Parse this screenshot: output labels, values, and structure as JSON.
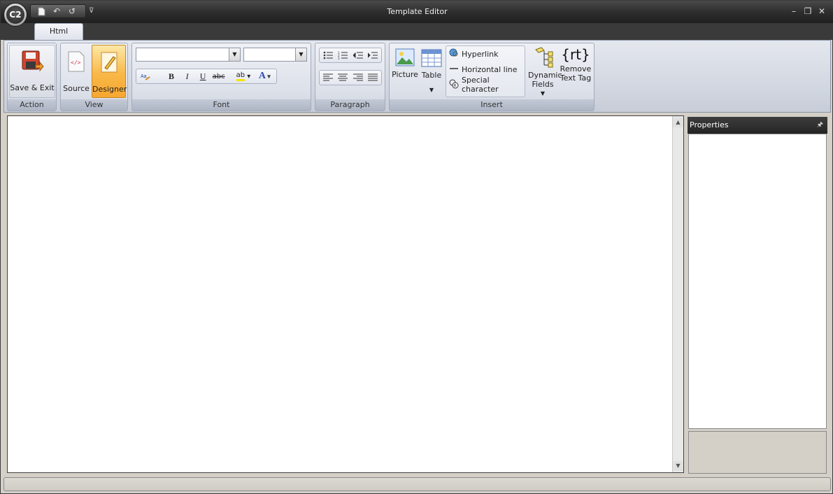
{
  "window": {
    "title": "Template Editor",
    "app_logo": "C2"
  },
  "tabs": [
    {
      "label": "Html",
      "selected": true
    }
  ],
  "ribbon": {
    "action": {
      "group_label": "Action",
      "save_exit_label": "Save & Exit"
    },
    "view": {
      "group_label": "View",
      "source_label": "Source",
      "designer_label": "Designer",
      "active": "Designer"
    },
    "font": {
      "group_label": "Font",
      "font_name_value": "",
      "font_size_value": ""
    },
    "paragraph": {
      "group_label": "Paragraph"
    },
    "insert": {
      "group_label": "Insert",
      "picture_label": "Picture",
      "table_label": "Table",
      "hyperlink_label": "Hyperlink",
      "horizontal_line_label": "Horizontal line",
      "special_character_label": "Special character",
      "dynamic_fields_label_1": "Dynamic",
      "dynamic_fields_label_2": "Fields",
      "remove_text_tag_label_1": "Remove",
      "remove_text_tag_label_2": "Text Tag",
      "rt_glyph": "{rt}"
    }
  },
  "properties_panel": {
    "title": "Properties"
  },
  "colors": {
    "designer_active": "#f9b848",
    "titlebar": "#2e2e2e",
    "ribbon": "#d3d8e2"
  }
}
